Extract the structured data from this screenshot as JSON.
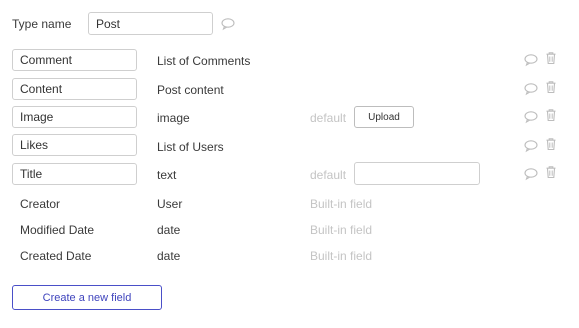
{
  "type": {
    "label": "Type name",
    "value": "Post"
  },
  "fields": [
    {
      "name": "Comment",
      "type": "List of Comments"
    },
    {
      "name": "Content",
      "type": "Post content"
    },
    {
      "name": "Image",
      "type": "image",
      "default_label": "default",
      "upload_label": "Upload"
    },
    {
      "name": "Likes",
      "type": "List of Users"
    },
    {
      "name": "Title",
      "type": "text",
      "default_label": "default",
      "default_value": ""
    }
  ],
  "builtin_fields": [
    {
      "name": "Creator",
      "type": "User",
      "note": "Built-in field"
    },
    {
      "name": "Modified Date",
      "type": "date",
      "note": "Built-in field"
    },
    {
      "name": "Created Date",
      "type": "date",
      "note": "Built-in field"
    }
  ],
  "create_button_label": "Create a new field",
  "icons": {
    "comment": "comment-bubble-icon",
    "delete": "trash-icon"
  },
  "colors": {
    "accent": "#4a4fc8",
    "muted_text": "#c4c4c4",
    "icon": "#bdbdbd"
  }
}
